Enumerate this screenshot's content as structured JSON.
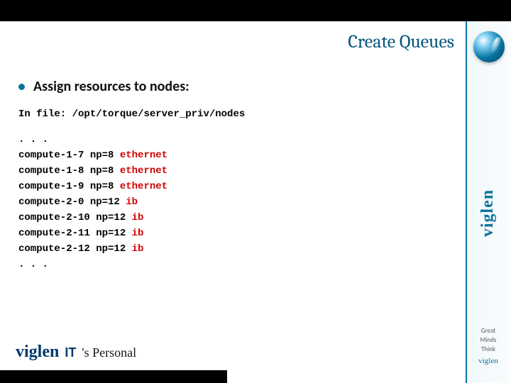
{
  "brand": {
    "name": "viglen",
    "footer_it": "IT",
    "footer_personal": "'s Personal",
    "tagline_line1": "Great",
    "tagline_line2": "Minds",
    "tagline_line3": "Think"
  },
  "slide": {
    "title": "Create Queues",
    "bullet": "Assign resources to nodes:",
    "file_line_prefix": "In file: ",
    "file_path": "/opt/torque/server_priv/nodes",
    "nodes_leading_ellipsis": ". . .",
    "nodes": [
      {
        "host": "compute-1-7",
        "np": "np=8",
        "net": "ethernet"
      },
      {
        "host": "compute-1-8",
        "np": "np=8",
        "net": "ethernet"
      },
      {
        "host": "compute-1-9",
        "np": "np=8",
        "net": "ethernet"
      },
      {
        "host": "compute-2-0",
        "np": "np=12",
        "net": "ib"
      },
      {
        "host": "compute-2-10",
        "np": "np=12",
        "net": "ib"
      },
      {
        "host": "compute-2-11",
        "np": "np=12",
        "net": "ib"
      },
      {
        "host": "compute-2-12",
        "np": "np=12",
        "net": "ib"
      }
    ],
    "nodes_trailing_ellipsis": ". . ."
  }
}
